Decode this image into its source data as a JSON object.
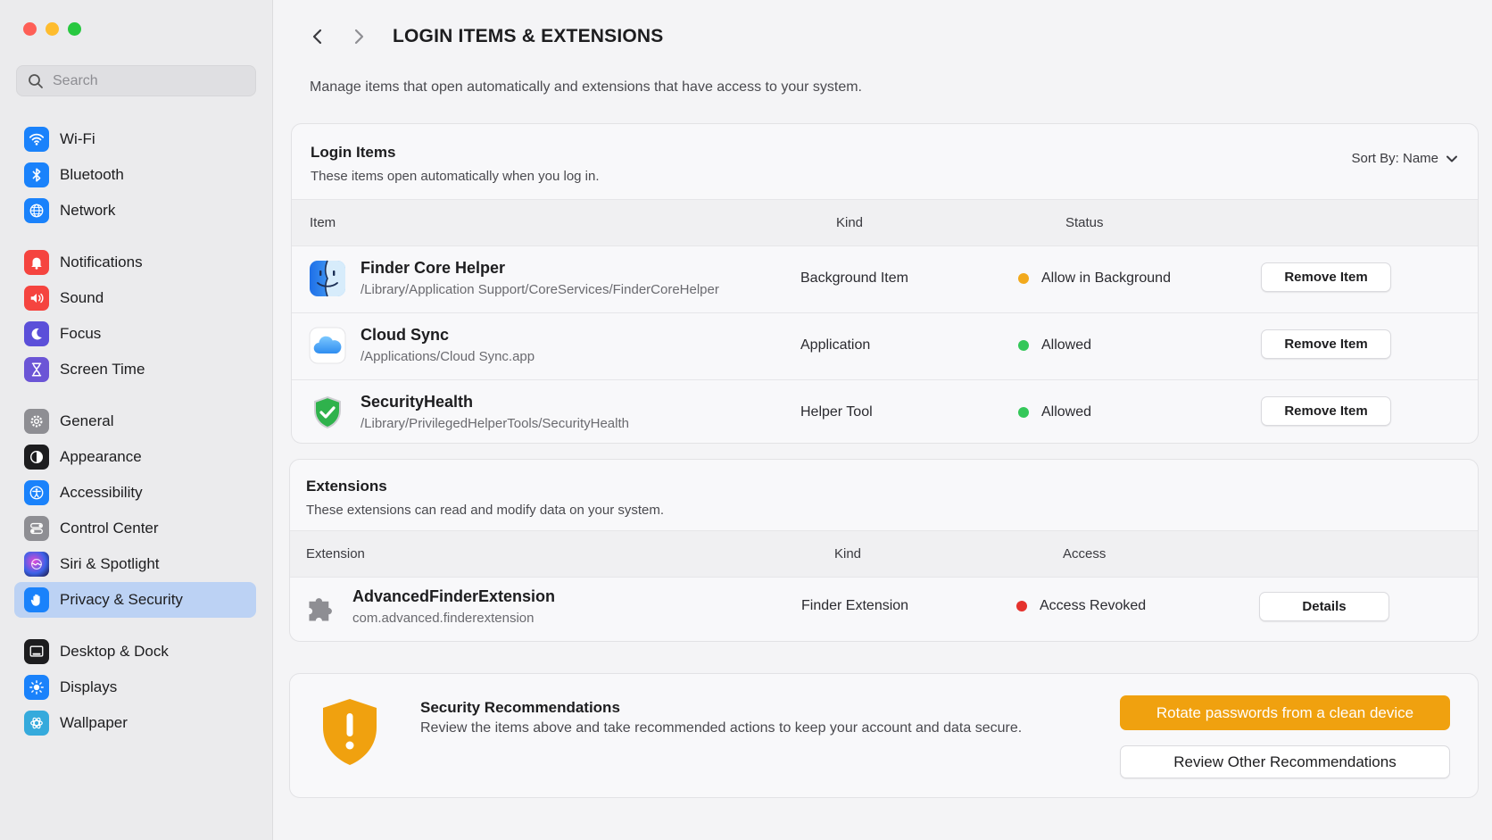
{
  "window": {
    "controls": [
      "close",
      "minimize",
      "zoom"
    ]
  },
  "sidebar": {
    "search": {
      "placeholder": "Search",
      "value": ""
    },
    "items": [
      {
        "label": "Wi-Fi",
        "icon": "wifi-icon",
        "color": "#1a82fb"
      },
      {
        "label": "Bluetooth",
        "icon": "bluetooth-icon",
        "color": "#1a82fb"
      },
      {
        "label": "Network",
        "icon": "globe-icon",
        "color": "#1a82fb"
      },
      {
        "label": "Notifications",
        "icon": "bell-icon",
        "color": "#f5443f"
      },
      {
        "label": "Sound",
        "icon": "speaker-icon",
        "color": "#f5443f"
      },
      {
        "label": "Focus",
        "icon": "moon-icon",
        "color": "#5b4fd9"
      },
      {
        "label": "Screen Time",
        "icon": "hourglass-icon",
        "color": "#6b55d6"
      },
      {
        "label": "General",
        "icon": "gear-icon",
        "color": "#8e8e93"
      },
      {
        "label": "Appearance",
        "icon": "appearance-icon",
        "color": "#1d1d1f"
      },
      {
        "label": "Accessibility",
        "icon": "accessibility-icon",
        "color": "#1a82fb"
      },
      {
        "label": "Control Center",
        "icon": "toggles-icon",
        "color": "#8e8e93"
      },
      {
        "label": "Siri & Spotlight",
        "icon": "siri-icon",
        "color": "#3b2a6e"
      },
      {
        "label": "Privacy & Security",
        "icon": "hand-icon",
        "color": "#1a82fb",
        "selected": true
      },
      {
        "label": "Desktop & Dock",
        "icon": "dock-icon",
        "color": "#1d1d1f"
      },
      {
        "label": "Displays",
        "icon": "sun-icon",
        "color": "#1a82fb"
      },
      {
        "label": "Wallpaper",
        "icon": "wallpaper-icon",
        "color": "#35aadc"
      }
    ]
  },
  "header": {
    "title": "LOGIN ITEMS & EXTENSIONS",
    "subtitle": "Manage items that open automatically and extensions that have access to your system."
  },
  "login_items": {
    "title": "Login Items",
    "description": "These items open automatically when you log in.",
    "sort_label": "Sort By: Name",
    "columns": {
      "item": "Item",
      "kind": "Kind",
      "status": "Status"
    },
    "rows": [
      {
        "name": "Finder Core Helper",
        "path": "/Library/Application Support/CoreServices/FinderCoreHelper",
        "kind": "Background Item",
        "status": "Allow in Background",
        "status_color": "#f2a91c",
        "action": "Remove Item",
        "icon": "finder-icon"
      },
      {
        "name": "Cloud Sync",
        "path": "/Applications/Cloud Sync.app",
        "kind": "Application",
        "status": "Allowed",
        "status_color": "#34c759",
        "action": "Remove Item",
        "icon": "cloud-icon"
      },
      {
        "name": "SecurityHealth",
        "path": "/Library/PrivilegedHelperTools/SecurityHealth",
        "kind": "Helper Tool",
        "status": "Allowed",
        "status_color": "#34c759",
        "action": "Remove Item",
        "icon": "shield-check-icon"
      }
    ]
  },
  "extensions": {
    "title": "Extensions",
    "description": "These extensions can read and modify data on your system.",
    "columns": {
      "extension": "Extension",
      "kind": "Kind",
      "access": "Access"
    },
    "rows": [
      {
        "name": "AdvancedFinderExtension",
        "id": "com.advanced.finderextension",
        "kind": "Finder Extension",
        "access": "Access Revoked",
        "access_color": "#e5322d",
        "action": "Details",
        "icon": "puzzle-icon"
      }
    ]
  },
  "security": {
    "title": "Security Recommendations",
    "description": "Review the items above and take recommended actions to keep your account and data secure.",
    "primary_action": "Rotate passwords from a clean device",
    "secondary_action": "Review Other Recommendations",
    "accent": "#f0a10f"
  }
}
